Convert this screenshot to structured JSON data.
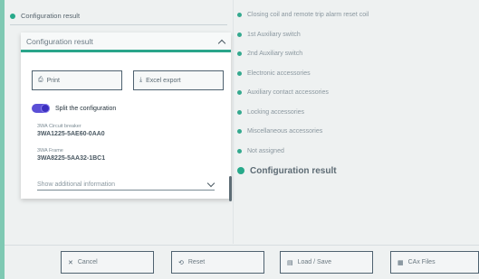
{
  "breadcrumb": {
    "label": "Configuration result"
  },
  "panel": {
    "title": "Configuration result",
    "print_label": "Print",
    "excel_label": "Excel export",
    "split_label": "Split the configuration",
    "split_on": true,
    "specs": [
      {
        "label": "3WA Circuit breaker",
        "value": "3WA1225-5AE60-0AA0"
      },
      {
        "label": "3WA Frame",
        "value": "3WA8225-5AA32-1BC1"
      }
    ],
    "more_label": "Show additional information"
  },
  "right_list": {
    "items": [
      "Closing coil and remote trip alarm reset coil",
      "1st Auxiliary switch",
      "2nd Auxiliary switch",
      "Electronic accessories",
      "Auxiliary contact accessories",
      "Locking accessories",
      "Miscellaneous accessories",
      "Not assigned"
    ],
    "active": "Configuration result"
  },
  "footer": {
    "cancel": "Cancel",
    "reset": "Reset",
    "load_save": "Load / Save",
    "cax_files": "CAx Files"
  },
  "colors": {
    "accent": "#2aa58a",
    "toggle": "#5b4fd6",
    "frame": "#7fc9b3"
  }
}
